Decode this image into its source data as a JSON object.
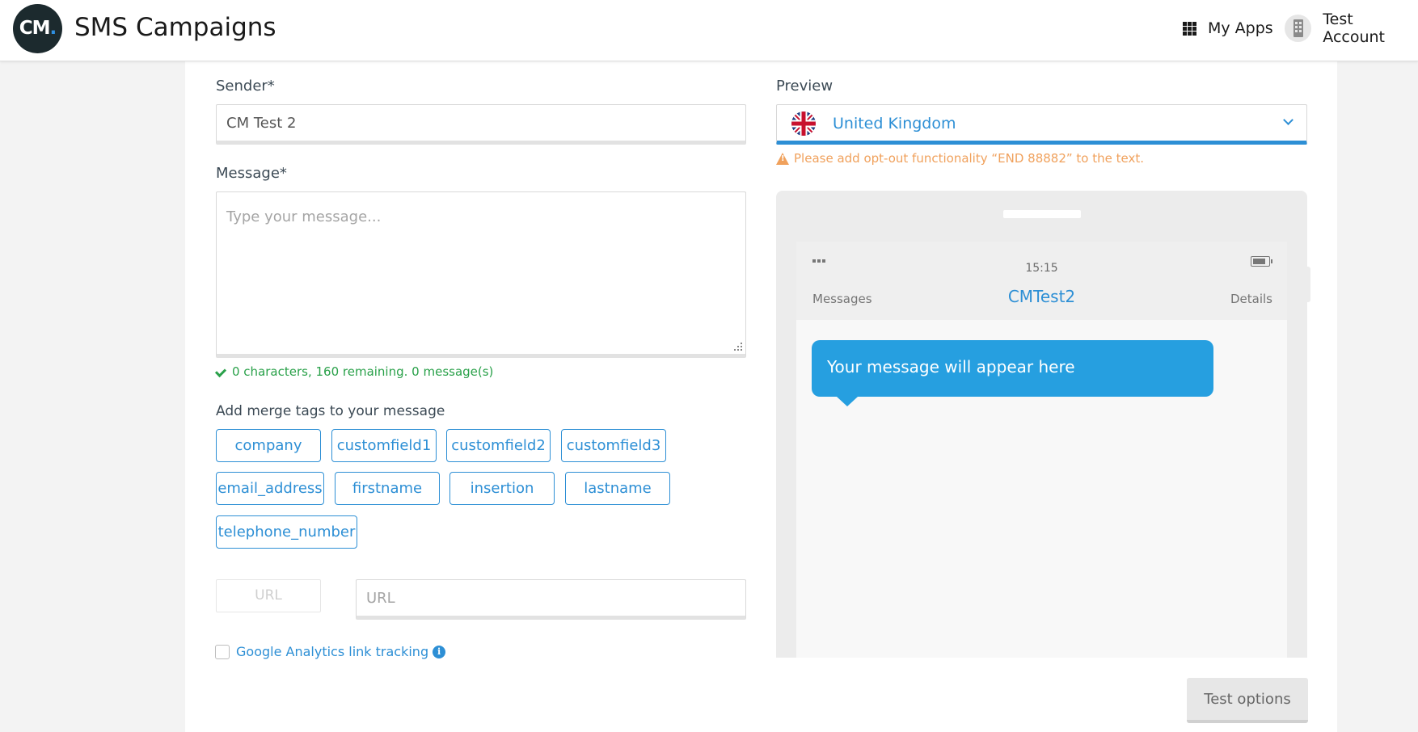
{
  "header": {
    "logo_text": "CM",
    "logo_dot": ".",
    "title": "SMS Campaigns",
    "apps_label": "My Apps",
    "account_label": "Test Account"
  },
  "form": {
    "sender_label": "Sender*",
    "sender_value": "CM Test 2",
    "message_label": "Message*",
    "message_placeholder": "Type your message...",
    "counter_text": "0 characters, 160 remaining. 0 message(s)",
    "merge_tags_label": "Add merge tags to your message",
    "merge_tags": [
      "company",
      "customfield1",
      "customfield2",
      "customfield3",
      "email_address",
      "firstname",
      "insertion",
      "lastname",
      "telephone_number"
    ],
    "url_button_label": "URL",
    "url_placeholder": "URL",
    "ga_label": "Google Analytics link tracking",
    "ga_info_glyph": "i"
  },
  "preview": {
    "label": "Preview",
    "country": "United Kingdom",
    "warning": "Please add opt-out functionality “END 88882” to the text.",
    "phone": {
      "time": "15:15",
      "back_label": "Messages",
      "contact_name": "CMTest2",
      "details_label": "Details",
      "bubble_text": "Your message will appear here"
    }
  },
  "actions": {
    "test_options_label": "Test options"
  },
  "colors": {
    "accent": "#2d8fd5",
    "success": "#2aa14a",
    "warning": "#f0a15c",
    "bubble": "#269fe0"
  }
}
